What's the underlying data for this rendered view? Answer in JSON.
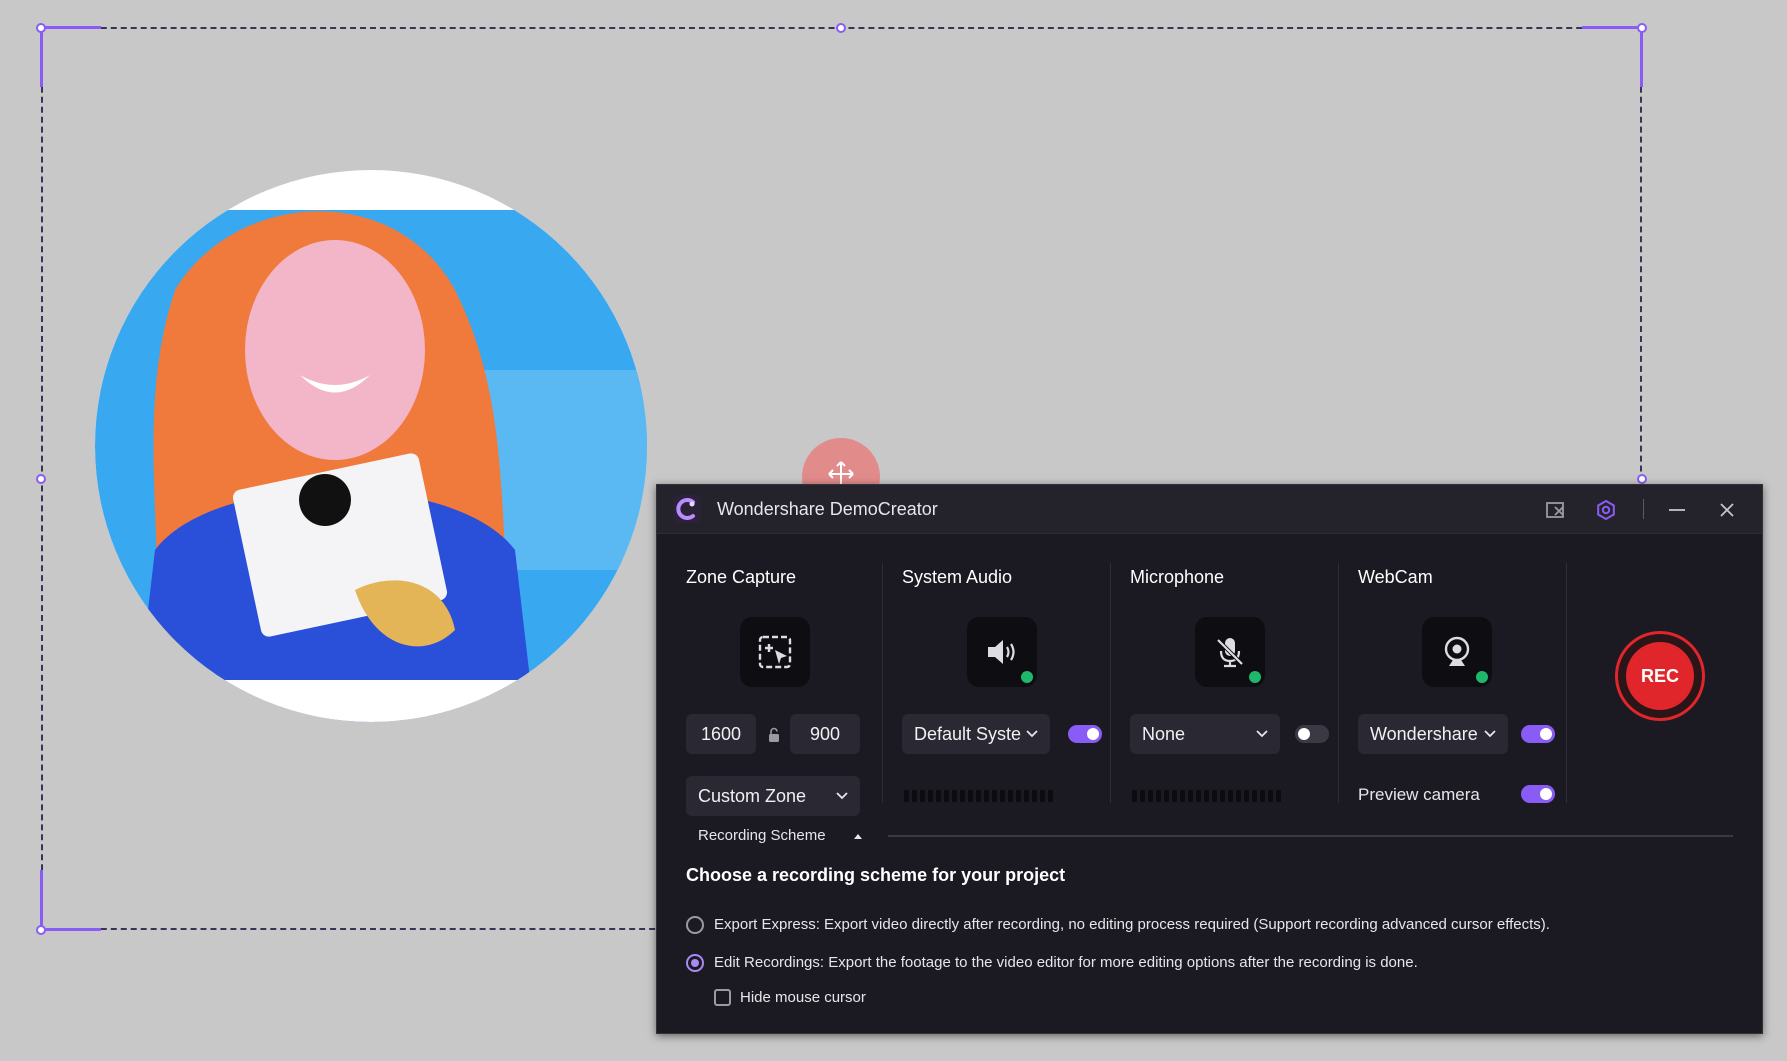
{
  "app": {
    "title": "Wondershare DemoCreator"
  },
  "columns": {
    "zone_capture": {
      "title": "Zone Capture",
      "width_value": "1600",
      "height_value": "900",
      "zone_mode": "Custom Zone",
      "icon": "zone-capture-icon"
    },
    "system_audio": {
      "title": "System Audio",
      "device": "Default Syste",
      "enabled": true,
      "icon": "speaker-icon"
    },
    "microphone": {
      "title": "Microphone",
      "device": "None",
      "enabled": false,
      "icon": "microphone-muted-icon"
    },
    "webcam": {
      "title": "WebCam",
      "device": "Wondershare",
      "enabled": true,
      "preview_label": "Preview camera",
      "preview_enabled": true,
      "icon": "webcam-icon"
    }
  },
  "rec_button": {
    "label": "REC"
  },
  "recording_scheme": {
    "toggle_label": "Recording Scheme",
    "heading": "Choose a recording scheme for your project",
    "options": [
      {
        "label": "Export Express: Export video directly after recording, no editing process required (Support recording advanced cursor effects).",
        "selected": false
      },
      {
        "label": "Edit Recordings: Export the footage to the video editor for more editing options after the recording is done.",
        "selected": true
      }
    ],
    "hide_cursor_label": "Hide mouse cursor",
    "hide_cursor_checked": false
  },
  "colors": {
    "accent": "#8a5cf6",
    "rec_red": "#e0262a",
    "status_green": "#1fb86b",
    "window_bg": "#1b1a22"
  }
}
